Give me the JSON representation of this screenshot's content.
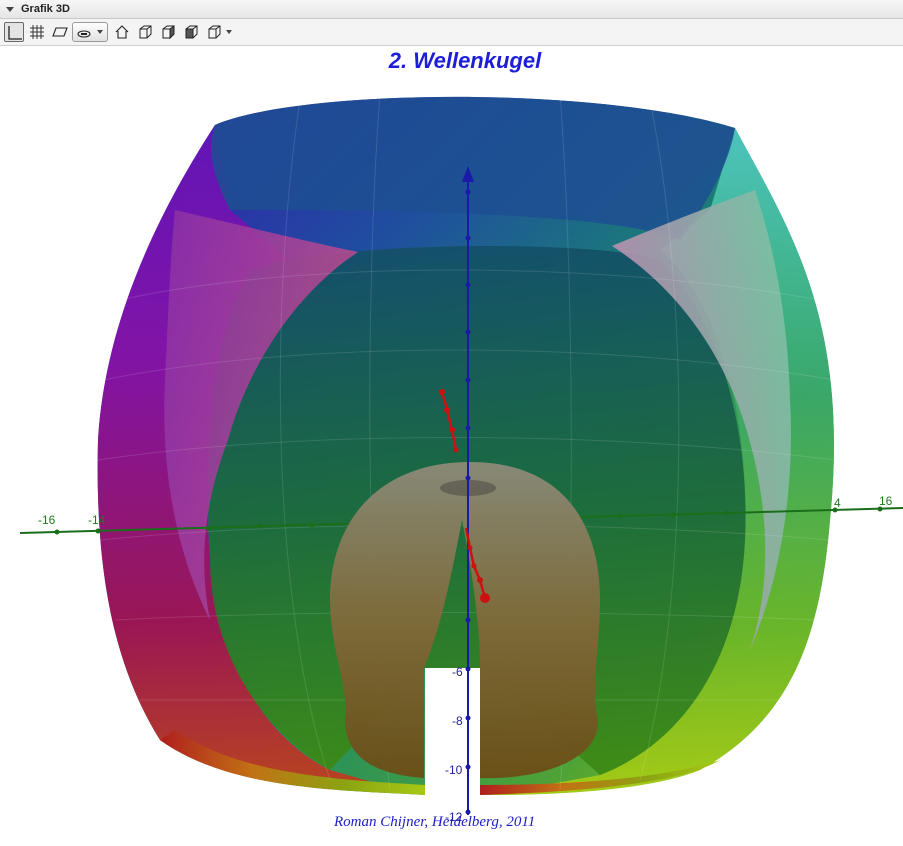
{
  "panel": {
    "title": "Grafik 3D"
  },
  "toolbar": {
    "buttons": [
      {
        "name": "axes-toggle-icon",
        "active": true
      },
      {
        "name": "grid-toggle-icon",
        "active": false
      },
      {
        "name": "plane-toggle-icon",
        "active": false
      },
      {
        "name": "clipping-box-icon",
        "active": false
      },
      {
        "name": "home-view-icon",
        "active": false
      },
      {
        "name": "view-front-icon",
        "active": false
      },
      {
        "name": "view-side-icon",
        "active": false
      },
      {
        "name": "view-top-icon",
        "active": false
      },
      {
        "name": "projection-icon",
        "active": false
      }
    ]
  },
  "view": {
    "title": "2. Wellenkugel",
    "credit": "Roman Chijner, Heidelberg, 2011",
    "x_axis_labels": [
      "-16",
      "-14",
      "4",
      "16"
    ],
    "z_axis_labels": [
      "-6",
      "-8",
      "-10",
      "-12"
    ],
    "colors": {
      "title": "#1d1ed8",
      "x_axis": "#1e7a1e",
      "z_axis": "#1a1aa8",
      "curve": "#cc1111"
    }
  }
}
